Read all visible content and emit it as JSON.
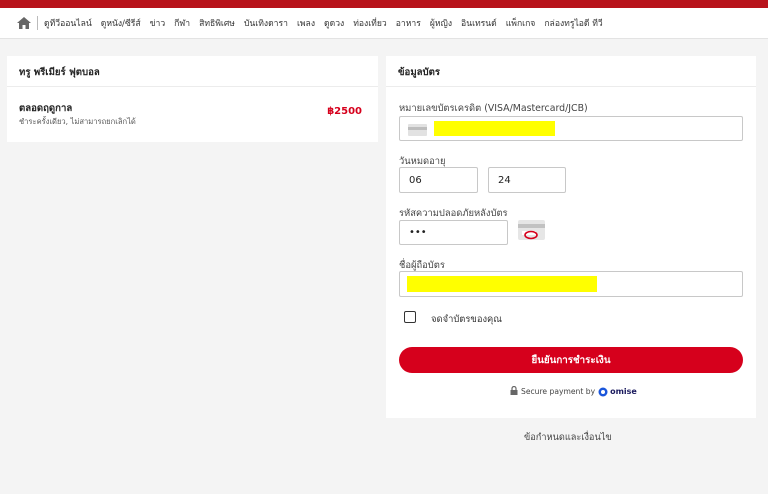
{
  "nav": {
    "items": [
      "ดูทีวีออนไลน์",
      "ดูหนัง/ซีรีส์",
      "ข่าว",
      "กีฬา",
      "สิทธิพิเศษ",
      "บันเทิงดารา",
      "เพลง",
      "ดูดวง",
      "ท่องเที่ยว",
      "อาหาร",
      "ผู้หญิง",
      "อินเทรนด์",
      "แพ็กเกจ",
      "กล่องทรูไอดี ทีวี"
    ]
  },
  "plan": {
    "section_title": "ทรู พรีเมียร์ ฟุตบอล",
    "name": "ตลอดฤดูกาล",
    "description": "ชำระครั้งเดียว, ไม่สามารถยกเลิกได้",
    "price": "฿2500"
  },
  "card": {
    "section_title": "ข้อมูลบัตร",
    "number_label": "หมายเลขบัตรเครดิต (VISA/Mastercard/JCB)",
    "number_value": "",
    "expiry_label": "วันหมดอายุ",
    "expiry_month": "06",
    "expiry_year": "24",
    "cvv_label": "รหัสความปลอดภัยหลังบัตร",
    "cvv_value": "•••",
    "holder_label": "ชื่อผู้ถือบัตร",
    "holder_value": "",
    "remember_label": "จดจำบัตรของคุณ",
    "confirm_label": "ยืนยันการชำระเงิน",
    "secure_text": "Secure payment by",
    "omise_label": "omise"
  },
  "footer": {
    "terms": "ข้อกำหนดและเงื่อนไข"
  },
  "colors": {
    "accent": "#d6001c",
    "highlight": "#ffff00"
  }
}
